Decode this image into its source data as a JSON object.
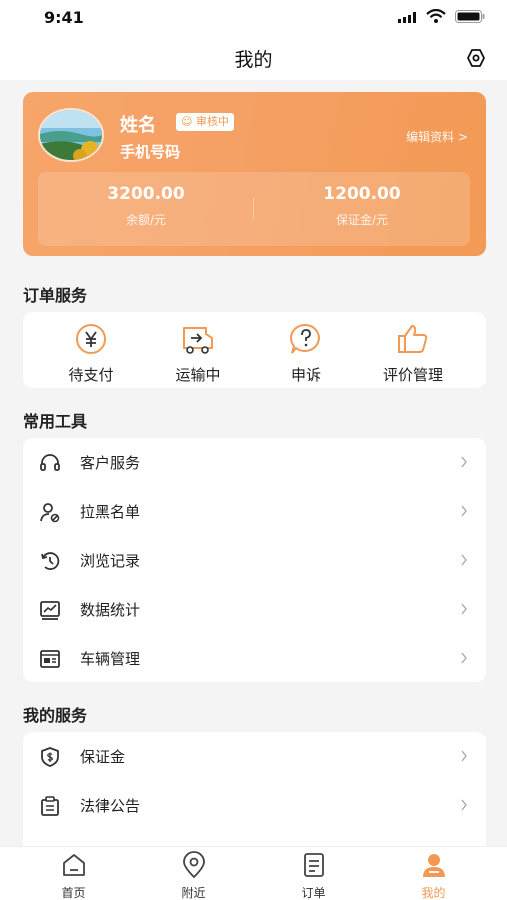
{
  "status_bar": {
    "time": "9:41"
  },
  "header": {
    "title": "我的"
  },
  "profile": {
    "name": "姓名",
    "badge": "审核中",
    "phone": "手机号码",
    "edit_link": "编辑资料 >",
    "balance": {
      "value": "3200.00",
      "label": "余额/元"
    },
    "deposit": {
      "value": "1200.00",
      "label": "保证金/元"
    }
  },
  "order_services": {
    "title": "订单服务",
    "items": [
      {
        "label": "待支付",
        "icon": "yen-coin-icon"
      },
      {
        "label": "运输中",
        "icon": "truck-icon"
      },
      {
        "label": "申诉",
        "icon": "question-bubble-icon"
      },
      {
        "label": "评价管理",
        "icon": "thumbs-up-icon"
      }
    ]
  },
  "tools": {
    "title": "常用工具",
    "items": [
      {
        "label": "客户服务",
        "icon": "headset-icon"
      },
      {
        "label": "拉黑名单",
        "icon": "block-user-icon"
      },
      {
        "label": "浏览记录",
        "icon": "history-icon"
      },
      {
        "label": "数据统计",
        "icon": "chart-icon"
      },
      {
        "label": "车辆管理",
        "icon": "vehicle-card-icon"
      }
    ]
  },
  "my_services": {
    "title": "我的服务",
    "items": [
      {
        "label": "保证金",
        "icon": "shield-dollar-icon"
      },
      {
        "label": "法律公告",
        "icon": "clipboard-icon"
      }
    ]
  },
  "tab_bar": {
    "items": [
      {
        "label": "首页",
        "icon": "home-icon"
      },
      {
        "label": "附近",
        "icon": "location-pin-icon"
      },
      {
        "label": "订单",
        "icon": "order-list-icon"
      },
      {
        "label": "我的",
        "icon": "user-icon",
        "active": true
      }
    ]
  },
  "colors": {
    "accent": "#f29a55",
    "background": "#f4f4f5"
  }
}
